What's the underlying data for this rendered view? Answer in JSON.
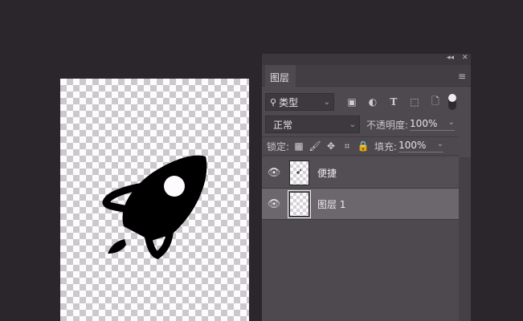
{
  "panel": {
    "collapse_label": "◂◂",
    "close_label": "✕",
    "tab": "图层",
    "menu_icon": "≡",
    "filter": {
      "kind": "类型",
      "icons": [
        "image-filter-icon",
        "adjustment-filter-icon",
        "type-filter-icon",
        "shape-filter-icon",
        "smart-object-filter-icon",
        "filter-toggle-icon"
      ]
    },
    "blend_mode": "正常",
    "opacity_label": "不透明度:",
    "opacity": "100%",
    "lock_label": "锁定:",
    "fill_label": "填充:",
    "fill": "100%",
    "layers": [
      {
        "name": "便捷",
        "visible": true,
        "selected": false
      },
      {
        "name": "图层 1",
        "visible": true,
        "selected": true
      }
    ]
  },
  "colors": {
    "background": "#2a262b",
    "panel": "#4d494f",
    "selected_layer": "#6b676d"
  }
}
